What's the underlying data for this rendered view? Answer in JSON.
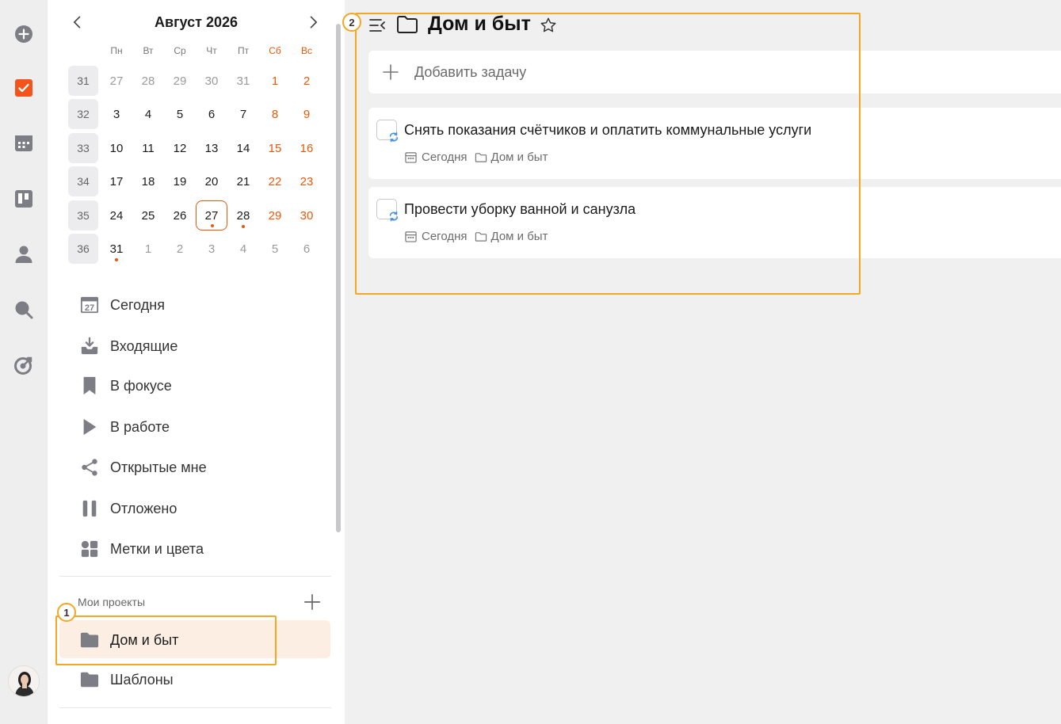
{
  "calendar": {
    "title": "Август 2026",
    "prev_icon": "chevron-left-icon",
    "next_icon": "chevron-right-icon",
    "weekdays": [
      "Пн",
      "Вт",
      "Ср",
      "Чт",
      "Пт",
      "Сб",
      "Вс"
    ],
    "weeks": [
      {
        "no": "31",
        "days": [
          "27",
          "28",
          "29",
          "30",
          "31",
          "1",
          "2"
        ]
      },
      {
        "no": "32",
        "days": [
          "3",
          "4",
          "5",
          "6",
          "7",
          "8",
          "9"
        ]
      },
      {
        "no": "33",
        "days": [
          "10",
          "11",
          "12",
          "13",
          "14",
          "15",
          "16"
        ]
      },
      {
        "no": "34",
        "days": [
          "17",
          "18",
          "19",
          "20",
          "21",
          "22",
          "23"
        ]
      },
      {
        "no": "35",
        "days": [
          "24",
          "25",
          "26",
          "27",
          "28",
          "29",
          "30"
        ]
      },
      {
        "no": "36",
        "days": [
          "31",
          "1",
          "2",
          "3",
          "4",
          "5",
          "6"
        ]
      }
    ],
    "today": "27",
    "weekend_color": "#e8590c"
  },
  "rail": {
    "icons": [
      "add-circle-icon",
      "tasks-checkbox-icon",
      "calendar-icon",
      "board-icon",
      "contacts-icon",
      "search-icon",
      "goal-target-icon"
    ],
    "active_color": "#f2541b"
  },
  "nav": {
    "items": [
      {
        "label": "Сегодня",
        "icon": "calendar-today-icon"
      },
      {
        "label": "Входящие",
        "icon": "inbox-icon"
      },
      {
        "label": "В фокусе",
        "icon": "bookmark-icon"
      },
      {
        "label": "В работе",
        "icon": "play-icon"
      },
      {
        "label": "Открытые мне",
        "icon": "share-icon"
      },
      {
        "label": "Отложено",
        "icon": "pause-icon"
      },
      {
        "label": "Метки и цвета",
        "icon": "tags-grid-icon"
      }
    ],
    "today_icon_number": "27"
  },
  "projects": {
    "section_title": "Мои проекты",
    "items": [
      {
        "label": "Дом и быт",
        "active": true
      },
      {
        "label": "Шаблоны",
        "active": false
      }
    ]
  },
  "main": {
    "title": "Дом и быт",
    "add_task_label": "Добавить задачу",
    "tasks": [
      {
        "title": "Снять показания счётчиков и оплатить коммунальные услуги",
        "date": "Сегодня",
        "project": "Дом и быт"
      },
      {
        "title": "Провести уборку ванной и санузла",
        "date": "Сегодня",
        "project": "Дом и быт"
      }
    ]
  },
  "callouts": {
    "one": "1",
    "two": "2",
    "color": "#f5a623"
  }
}
